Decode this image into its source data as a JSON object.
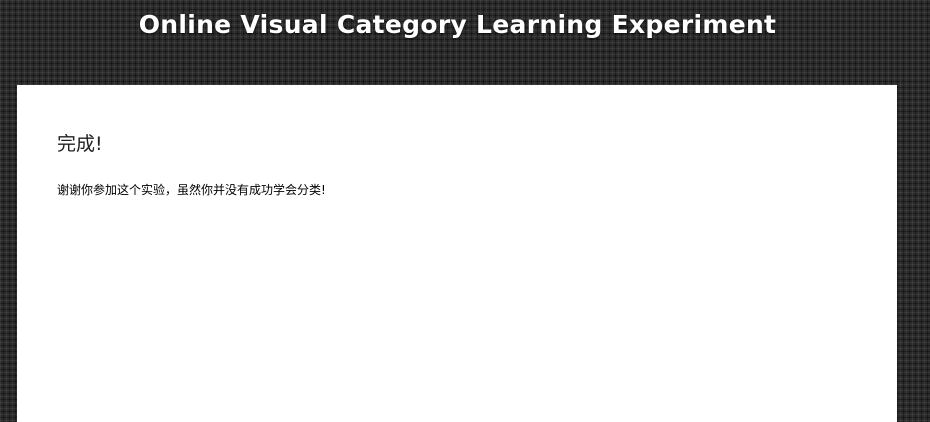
{
  "header": {
    "title": "Online Visual Category Learning Experiment"
  },
  "main": {
    "heading": "完成!",
    "message": "谢谢你参加这个实验，虽然你并没有成功学会分类!"
  },
  "colors": {
    "background": "#2b2b2b",
    "panel": "#ffffff",
    "title_text": "#ffffff"
  }
}
